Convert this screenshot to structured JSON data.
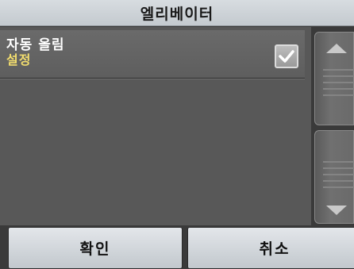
{
  "header": {
    "title": "엘리베이터"
  },
  "list": {
    "items": [
      {
        "label": "자동 올림",
        "sublabel": "설정",
        "checked": true
      }
    ]
  },
  "scrollbar": {
    "up_icon": "triangle-up-icon",
    "down_icon": "triangle-down-icon"
  },
  "buttons": {
    "ok_label": "확인",
    "cancel_label": "취소"
  },
  "colors": {
    "title_bar": "#cdd2d6",
    "list_background": "#585858",
    "item_background": "#646464",
    "sublabel": "#f2dd6e",
    "button": "#d4d8dc"
  }
}
